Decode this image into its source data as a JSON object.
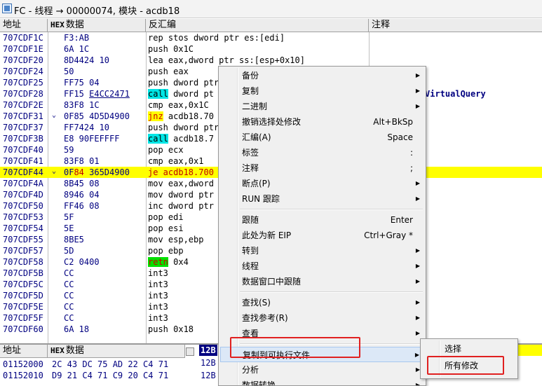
{
  "window": {
    "title": "FC - 线程 → 00000074, 模块 - acdb18",
    "icon": "app-icon"
  },
  "columns": {
    "address": "地址",
    "hex_prefix": "HEX",
    "hex": "数据",
    "disasm": "反汇编",
    "comment": "注释"
  },
  "rows": [
    {
      "addr": "707CDF1C",
      "hex": "F3:AB",
      "disasm": "rep stos dword ptr es:[edi]",
      "kw": "",
      "comment": ""
    },
    {
      "addr": "707CDF1E",
      "hex": "6A 1C",
      "disasm": "push 0x1C",
      "kw": "",
      "comment": ""
    },
    {
      "addr": "707CDF20",
      "hex": "8D4424 10",
      "disasm": "lea eax,dword ptr ss:[esp+0x10]",
      "kw": "",
      "comment": ""
    },
    {
      "addr": "707CDF24",
      "hex": "50",
      "disasm": "push eax",
      "kw": "",
      "comment": ""
    },
    {
      "addr": "707CDF25",
      "hex": "FF75 04",
      "disasm": "push dword ptr",
      "kw": "",
      "comment": ""
    },
    {
      "addr": "707CDF28",
      "hex_pre": "FF15 ",
      "hex_ul": "E4CC2471",
      "disasm_kw": "call",
      "disasm_rest": " dword pt",
      "kw": "call",
      "comment": "VirtualQuery"
    },
    {
      "addr": "707CDF2E",
      "hex": "83F8 1C",
      "disasm": "cmp eax,0x1C",
      "kw": "",
      "comment": ""
    },
    {
      "addr": "707CDF31",
      "mark": "⌄",
      "hex": "0F85 4D5D4900",
      "disasm_kw": "jnz",
      "disasm_rest": " acdb18.70",
      "kw": "jcc",
      "comment": ""
    },
    {
      "addr": "707CDF37",
      "hex": "FF7424 10",
      "disasm": "push dword ptr",
      "kw": "",
      "comment": ""
    },
    {
      "addr": "707CDF3B",
      "hex": "E8 90FEFFFF",
      "disasm_kw": "call",
      "disasm_rest": " acdb18.7",
      "kw": "call",
      "comment": ""
    },
    {
      "addr": "707CDF40",
      "hex": "59",
      "disasm": "pop ecx",
      "kw": "",
      "comment": ""
    },
    {
      "addr": "707CDF41",
      "hex": "83F8 01",
      "disasm": "cmp eax,0x1",
      "kw": "",
      "comment": ""
    },
    {
      "addr": "707CDF44",
      "mark": "⌄",
      "hex_pre": "0F",
      "hex_red": "84",
      "hex_post": " 365D4900",
      "disasm_red": "je acdb18.700",
      "kw": "red",
      "highlight": true,
      "comment": ""
    },
    {
      "addr": "707CDF4A",
      "hex": "8B45 08",
      "disasm": "mov eax,dword",
      "kw": "",
      "comment": ""
    },
    {
      "addr": "707CDF4D",
      "hex": "8946 04",
      "disasm": "mov dword ptr",
      "kw": "",
      "comment": ""
    },
    {
      "addr": "707CDF50",
      "hex": "FF46 08",
      "disasm": "inc dword ptr",
      "kw": "",
      "comment": ""
    },
    {
      "addr": "707CDF53",
      "hex": "5F",
      "disasm": "pop edi",
      "kw": "",
      "comment": ""
    },
    {
      "addr": "707CDF54",
      "hex": "5E",
      "disasm": "pop esi",
      "kw": "",
      "comment": ""
    },
    {
      "addr": "707CDF55",
      "hex": "8BE5",
      "disasm": "mov esp,ebp",
      "kw": "",
      "comment": ""
    },
    {
      "addr": "707CDF57",
      "hex": "5D",
      "disasm": "pop ebp",
      "kw": "",
      "comment": ""
    },
    {
      "addr": "707CDF58",
      "hex": "C2 0400",
      "disasm_kw": "retn",
      "disasm_rest": " 0x4",
      "kw": "ret",
      "comment": ""
    },
    {
      "addr": "707CDF5B",
      "hex": "CC",
      "disasm": "int3",
      "kw": "",
      "comment": ""
    },
    {
      "addr": "707CDF5C",
      "hex": "CC",
      "disasm": "int3",
      "kw": "",
      "comment": ""
    },
    {
      "addr": "707CDF5D",
      "hex": "CC",
      "disasm": "int3",
      "kw": "",
      "comment": ""
    },
    {
      "addr": "707CDF5E",
      "hex": "CC",
      "disasm": "int3",
      "kw": "",
      "comment": ""
    },
    {
      "addr": "707CDF5F",
      "hex": "CC",
      "disasm": "int3",
      "kw": "",
      "comment": ""
    },
    {
      "addr": "707CDF60",
      "hex": "6A 18",
      "disasm": "push 0x18",
      "kw": "",
      "comment": ""
    }
  ],
  "bottom": {
    "address": "地址",
    "hex_prefix": "HEX",
    "hex": "数据",
    "rows": [
      {
        "addr": "01152000",
        "hex": "2C 43 DC 75 AD 22 C4 71"
      },
      {
        "addr": "01152010",
        "hex": "D9 21 C4 71 C9 20 C4 71"
      }
    ],
    "stack": [
      "12B",
      "12B",
      "12B"
    ]
  },
  "context_menu": {
    "items": [
      {
        "label": "备份",
        "shortcut": "",
        "submenu": true
      },
      {
        "label": "复制",
        "shortcut": "",
        "submenu": true
      },
      {
        "label": "二进制",
        "shortcut": "",
        "submenu": true
      },
      {
        "label": "撤销选择处修改",
        "shortcut": "Alt+BkSp",
        "submenu": false
      },
      {
        "label": "汇编(A)",
        "shortcut": "Space",
        "submenu": false
      },
      {
        "label": "标签",
        "shortcut": ":",
        "submenu": false
      },
      {
        "label": "注释",
        "shortcut": ";",
        "submenu": false
      },
      {
        "label": "断点(P)",
        "shortcut": "",
        "submenu": true
      },
      {
        "label": "RUN 跟踪",
        "shortcut": "",
        "submenu": true
      },
      {
        "label": "跟随",
        "shortcut": "Enter",
        "submenu": false
      },
      {
        "label": "此处为新 EIP",
        "shortcut": "Ctrl+Gray *",
        "submenu": false
      },
      {
        "label": "转到",
        "shortcut": "",
        "submenu": true
      },
      {
        "label": "线程",
        "shortcut": "",
        "submenu": true
      },
      {
        "label": "数据窗口中跟随",
        "shortcut": "",
        "submenu": true
      },
      {
        "label": "查找(S)",
        "shortcut": "",
        "submenu": true
      },
      {
        "label": "查找参考(R)",
        "shortcut": "",
        "submenu": true
      },
      {
        "label": "查看",
        "shortcut": "",
        "submenu": true
      },
      {
        "label": "复制到可执行文件",
        "shortcut": "",
        "submenu": true,
        "hover": true
      },
      {
        "label": "分析",
        "shortcut": "",
        "submenu": true
      },
      {
        "label": "数据转换",
        "shortcut": "",
        "submenu": true
      }
    ]
  },
  "submenu": {
    "items": [
      {
        "label": "选择"
      },
      {
        "label": "所有修改"
      }
    ]
  },
  "colors": {
    "highlight_row": "#ffff00",
    "call_bg": "#00e5e5",
    "ret_bg": "#00e000",
    "annotation_red": "#e02020"
  }
}
